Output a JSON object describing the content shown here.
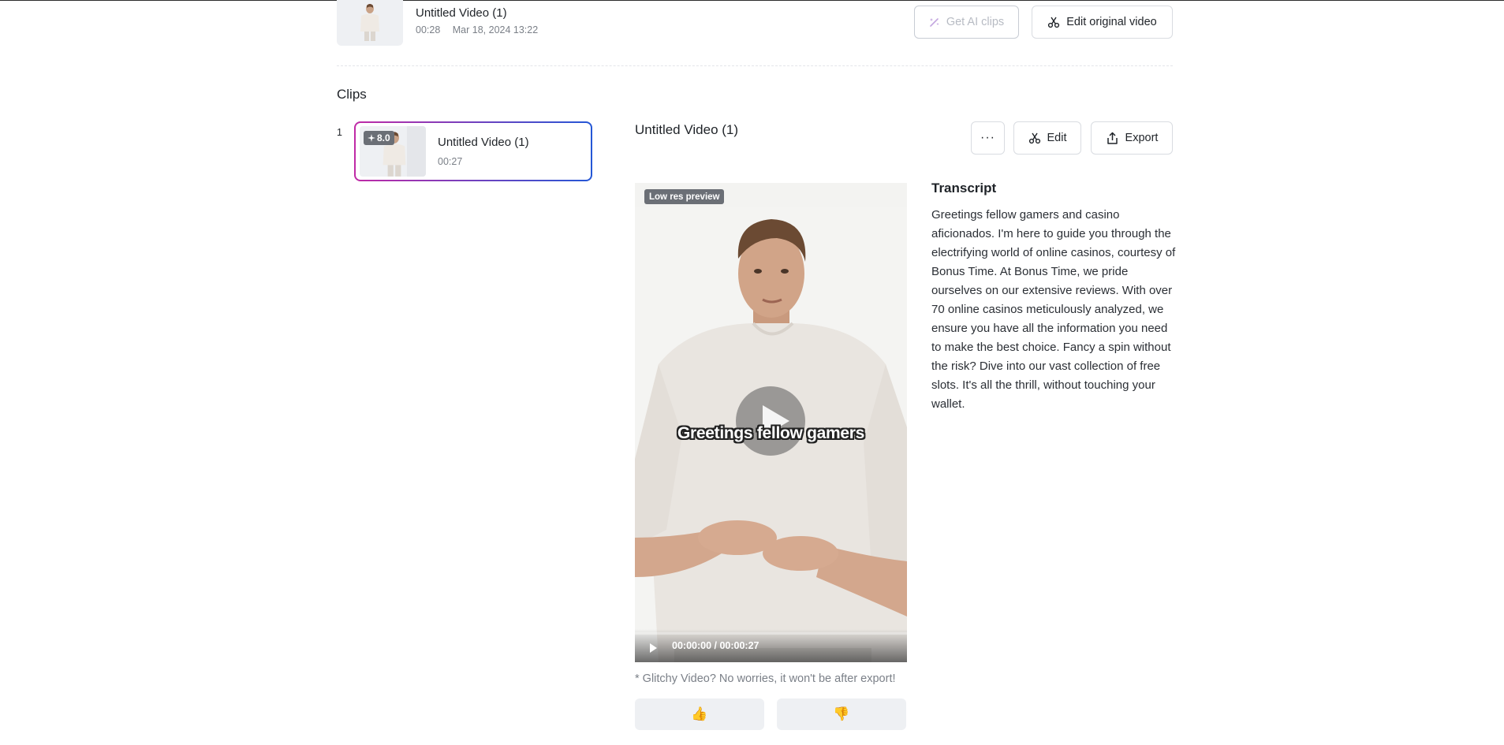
{
  "header": {
    "video_title": "Untitled Video (1)",
    "duration": "00:28",
    "date": "Mar 18, 2024 13:22",
    "get_ai_clips_label": "Get AI clips",
    "edit_original_label": "Edit original video"
  },
  "clips": {
    "heading": "Clips",
    "items": [
      {
        "index": "1",
        "score": "8.0",
        "title": "Untitled Video (1)",
        "duration": "00:27"
      }
    ]
  },
  "detail": {
    "title": "Untitled Video (1)",
    "more_label": "···",
    "edit_label": "Edit",
    "export_label": "Export",
    "preview_badge": "Low res preview",
    "caption": "Greetings fellow gamers",
    "time_display": "00:00:00 / 00:00:27",
    "glitch_note": "* Glitchy Video? No worries, it won't be after export!",
    "thumbs_up": "👍",
    "thumbs_down": "👎"
  },
  "transcript": {
    "heading": "Transcript",
    "text": "Greetings fellow gamers and casino aficionados. I'm here to guide you through the electrifying world of online casinos, courtesy of Bonus Time. At Bonus Time, we pride ourselves on our extensive reviews. With over 70 online casinos meticulously analyzed, we ensure you have all the information you need to make the best choice. Fancy a spin without the risk? Dive into our vast collection of free slots. It's all the thrill, without touching your wallet."
  },
  "colors": {
    "accent_gradient_start": "#c02aa6",
    "accent_gradient_end": "#2457d6",
    "badge_bg": "#6b6f76"
  }
}
